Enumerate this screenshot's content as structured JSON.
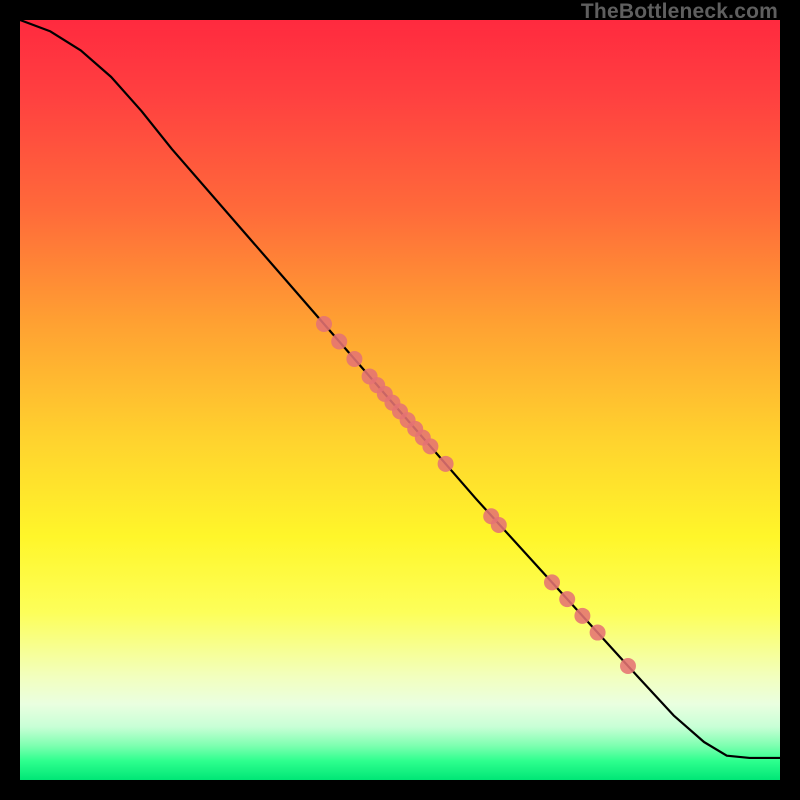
{
  "watermark": "TheBottleneck.com",
  "chart_data": {
    "type": "line",
    "title": "",
    "xlabel": "",
    "ylabel": "",
    "xlim": [
      0,
      100
    ],
    "ylim": [
      0,
      100
    ],
    "grid": false,
    "legend": false,
    "series": [
      {
        "name": "curve",
        "x": [
          0,
          4,
          8,
          12,
          16,
          20,
          30,
          40,
          50,
          60,
          70,
          80,
          86,
          90,
          93,
          96,
          100
        ],
        "y": [
          100,
          98.5,
          96,
          92.5,
          88,
          83,
          71.5,
          60,
          48.5,
          37,
          26,
          15,
          8.5,
          5,
          3.2,
          2.9,
          2.9
        ]
      }
    ],
    "markers": {
      "name": "highlight-points",
      "color": "#e57373",
      "radius": 8,
      "x": [
        40,
        42,
        44,
        46,
        47,
        48,
        49,
        50,
        51,
        52,
        53,
        54,
        56,
        62,
        63,
        70,
        72,
        74,
        76,
        80
      ],
      "y": [
        60,
        57.7,
        55.4,
        53.1,
        51.95,
        50.8,
        49.65,
        48.5,
        47.35,
        46.2,
        45.05,
        43.9,
        41.6,
        34.7,
        33.55,
        26,
        23.8,
        21.6,
        19.4,
        15
      ]
    }
  }
}
